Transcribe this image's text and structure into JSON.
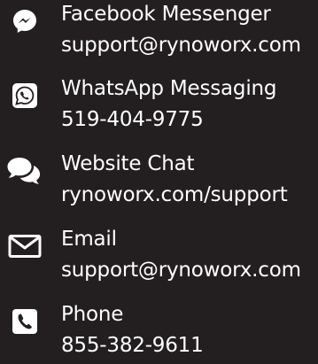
{
  "contacts": [
    {
      "icon": "messenger-icon",
      "title": "Facebook Messenger",
      "detail": "support@rynoworx.com"
    },
    {
      "icon": "whatsapp-icon",
      "title": "WhatsApp Messaging",
      "detail": "519-404-9775"
    },
    {
      "icon": "chat-bubbles-icon",
      "title": "Website Chat",
      "detail": "rynoworx.com/support"
    },
    {
      "icon": "envelope-icon",
      "title": "Email",
      "detail": "support@rynoworx.com"
    },
    {
      "icon": "phone-icon",
      "title": "Phone",
      "detail": "855-382-9611"
    }
  ],
  "colors": {
    "background": "#231f20",
    "text": "#ffffff"
  }
}
